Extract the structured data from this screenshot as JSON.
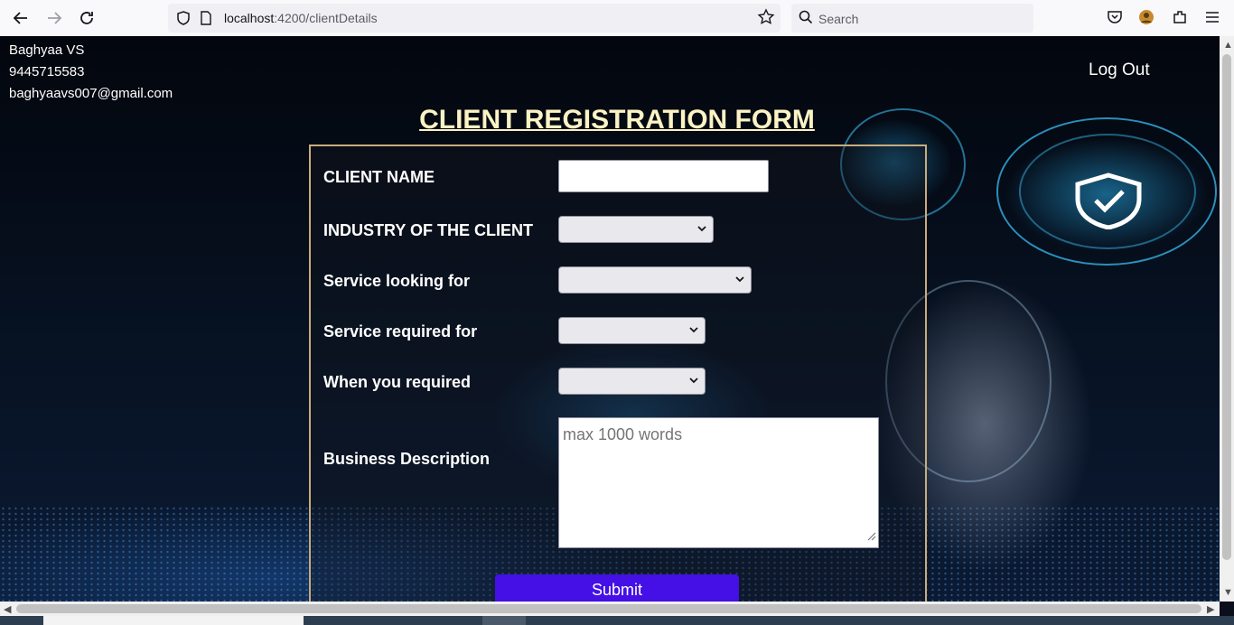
{
  "browser": {
    "url_host": "localhost",
    "url_path": ":4200/clientDetails",
    "search_placeholder": "Search"
  },
  "user": {
    "name": "Baghyaa VS",
    "phone": "9445715583",
    "email": "baghyaavs007@gmail.com"
  },
  "header": {
    "logout_label": "Log Out",
    "title": "CLIENT REGISTRATION FORM"
  },
  "form": {
    "client_name_label": "CLIENT NAME",
    "client_name_value": "",
    "industry_label": "INDUSTRY OF THE CLIENT",
    "industry_value": "",
    "service_looking_label": "Service looking for",
    "service_looking_value": "",
    "service_required_label": "Service required for",
    "service_required_value": "",
    "when_required_label": "When you required",
    "when_required_value": "",
    "description_label": "Business Description",
    "description_placeholder": "max 1000 words",
    "submit_label": "Submit"
  },
  "colors": {
    "title": "#fbf3c4",
    "form_border": "#c9ab7c",
    "submit_bg": "#4410e6"
  }
}
